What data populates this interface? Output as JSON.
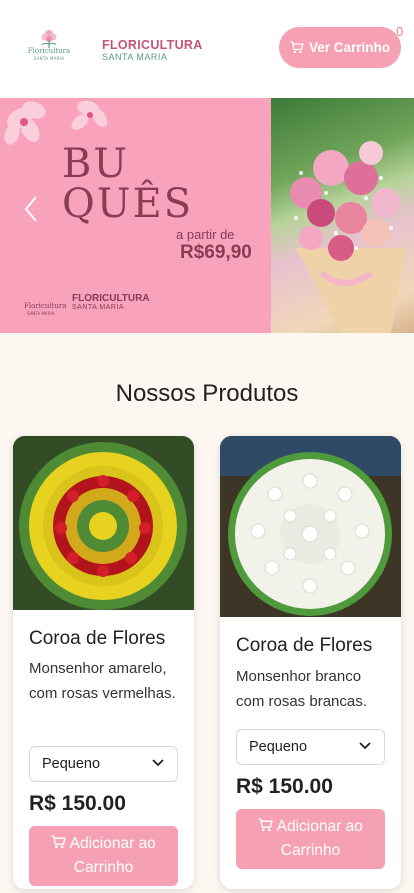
{
  "header": {
    "logo_small_name": "Floricultura",
    "logo_small_sub": "SANTA MARIA",
    "brand_title": "FLORICULTURA",
    "brand_sub": "SANTA MARIA",
    "cart_button_label": "Ver Carrinho",
    "cart_count": "0",
    "cart_icon": "cart-icon"
  },
  "banner": {
    "title_line1": "BU",
    "title_line2": "QUÊS",
    "from_label": "a partir de",
    "price": "R$69,90",
    "logo_small_name": "Floricultura",
    "logo_small_sub": "SANTA MARIA",
    "brand_title": "FLORICULTURA",
    "brand_sub": "SANTA MARIA",
    "prev_icon": "chevron-left-icon"
  },
  "products_section": {
    "title": "Nossos Produtos",
    "products": [
      {
        "name": "Coroa de Flores",
        "description": "Monsenhor amarelo, com rosas vermelhas.",
        "size_selected": "Pequeno",
        "price": "R$ 150.00",
        "add_button_label": "Adicionar ao Carrinho"
      },
      {
        "name": "Coroa de Flores",
        "description": "Monsenhor branco com rosas brancas.",
        "size_selected": "Pequeno",
        "price": "R$ 150.00",
        "add_button_label": "Adicionar ao Carrinho"
      }
    ]
  },
  "colors": {
    "accent_pink": "#f6a1b3",
    "brand_pink": "#c4547a",
    "brand_teal": "#5a9a8a",
    "banner_bg": "#f8a3bb",
    "page_bg": "#fdf7f2"
  }
}
